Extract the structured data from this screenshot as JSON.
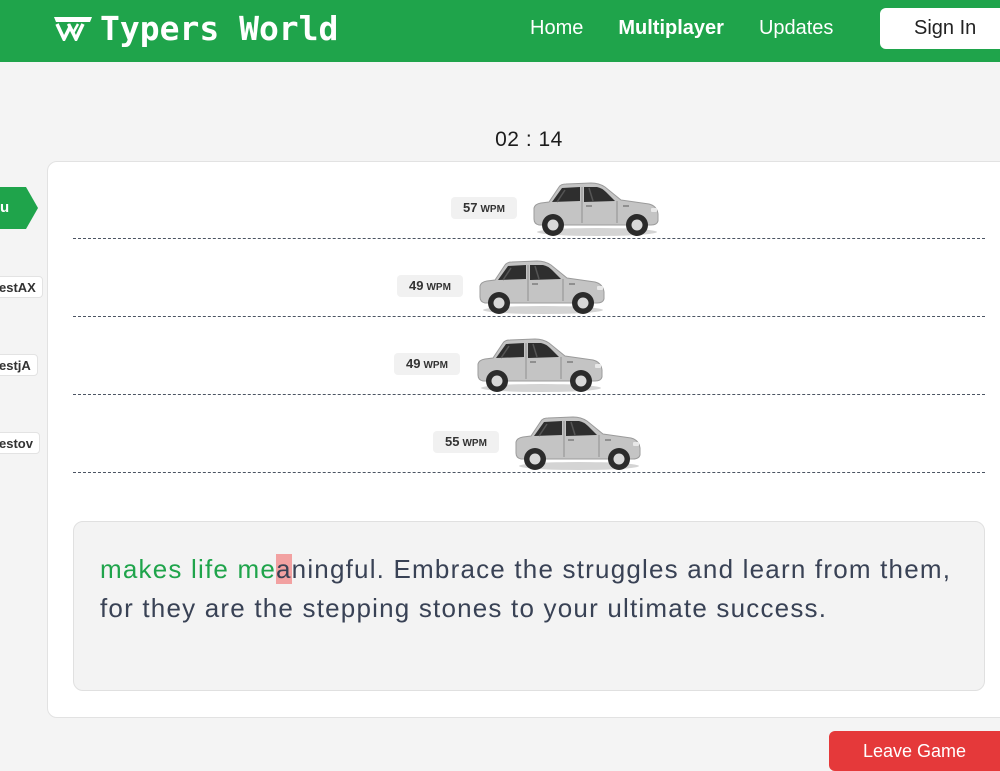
{
  "brand": {
    "name": "Typers World",
    "logo_icon": "tw-logo-icon"
  },
  "nav": {
    "links": [
      {
        "label": "Home",
        "bold": false
      },
      {
        "label": "Multiplayer",
        "bold": true
      },
      {
        "label": "Updates",
        "bold": false
      }
    ],
    "signin_label": "Sign In"
  },
  "timer": "02 : 14",
  "players": [
    {
      "side_label": "u",
      "wpm": "57",
      "wpm_unit": "WPM",
      "is_you": true
    },
    {
      "side_label": "estAX",
      "wpm": "49",
      "wpm_unit": "WPM",
      "is_you": false
    },
    {
      "side_label": "estjA",
      "wpm": "49",
      "wpm_unit": "WPM",
      "is_you": false
    },
    {
      "side_label": "estov",
      "wpm": "55",
      "wpm_unit": "WPM",
      "is_you": false
    }
  ],
  "typing": {
    "typed": "makes life me",
    "current": "a",
    "remaining": "ningful. Embrace the struggles and learn from them, for they are the stepping stones to your ultimate success."
  },
  "leave_label": "Leave Game",
  "colors": {
    "brand_green": "#1fa44b",
    "error_red": "#e5393a",
    "cursor_pink": "#f2a1a1"
  }
}
